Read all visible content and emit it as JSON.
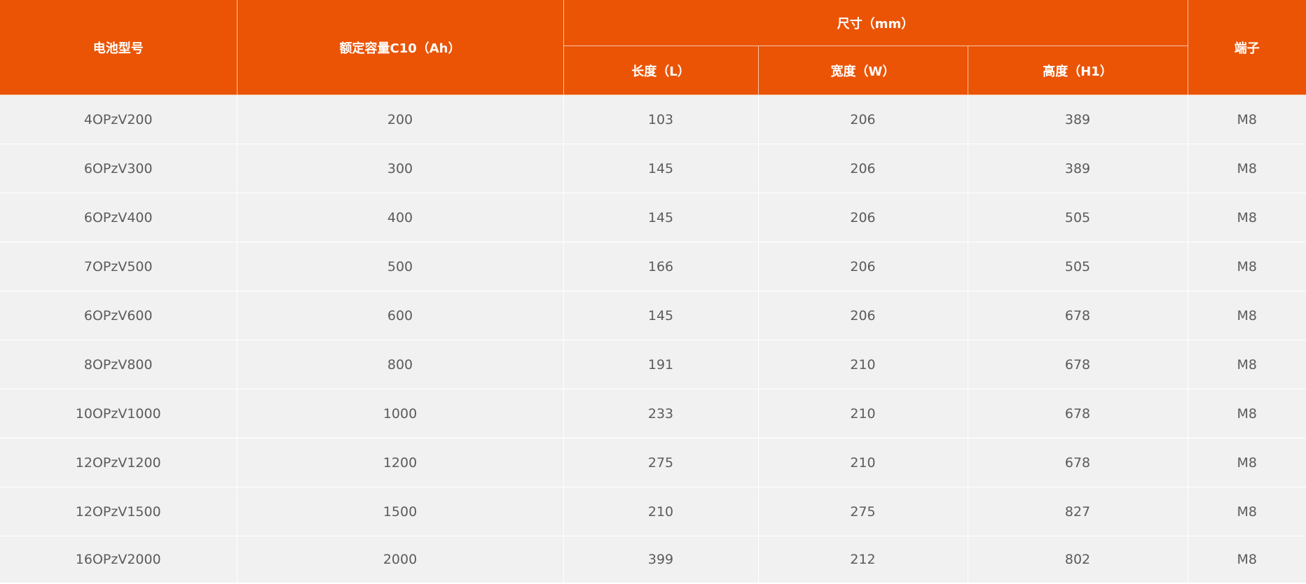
{
  "table": {
    "headers": {
      "model": "电池型号",
      "capacity": "额定容量C10（Ah）",
      "dimensions": "尺寸（mm）",
      "length": "长度（L）",
      "width": "宽度（W）",
      "height": "高度（H1）",
      "terminal": "端子"
    },
    "rows": [
      [
        "4OPzV200",
        "200",
        "103",
        "206",
        "389",
        "M8"
      ],
      [
        "6OPzV300",
        "300",
        "145",
        "206",
        "389",
        "M8"
      ],
      [
        "6OPzV400",
        "400",
        "145",
        "206",
        "505",
        "M8"
      ],
      [
        "7OPzV500",
        "500",
        "166",
        "206",
        "505",
        "M8"
      ],
      [
        "6OPzV600",
        "600",
        "145",
        "206",
        "678",
        "M8"
      ],
      [
        "8OPzV800",
        "800",
        "191",
        "210",
        "678",
        "M8"
      ],
      [
        "10OPzV1000",
        "1000",
        "233",
        "210",
        "678",
        "M8"
      ],
      [
        "12OPzV1200",
        "1200",
        "275",
        "210",
        "678",
        "M8"
      ],
      [
        "12OPzV1500",
        "1500",
        "210",
        "275",
        "827",
        "M8"
      ],
      [
        "16OPzV2000",
        "2000",
        "399",
        "212",
        "802",
        "M8"
      ]
    ]
  },
  "colors": {
    "header_bg": "#ea5404",
    "header_text": "#ffffff",
    "row_bg": "#f2f1f1",
    "row_text": "#5b5b5b"
  }
}
